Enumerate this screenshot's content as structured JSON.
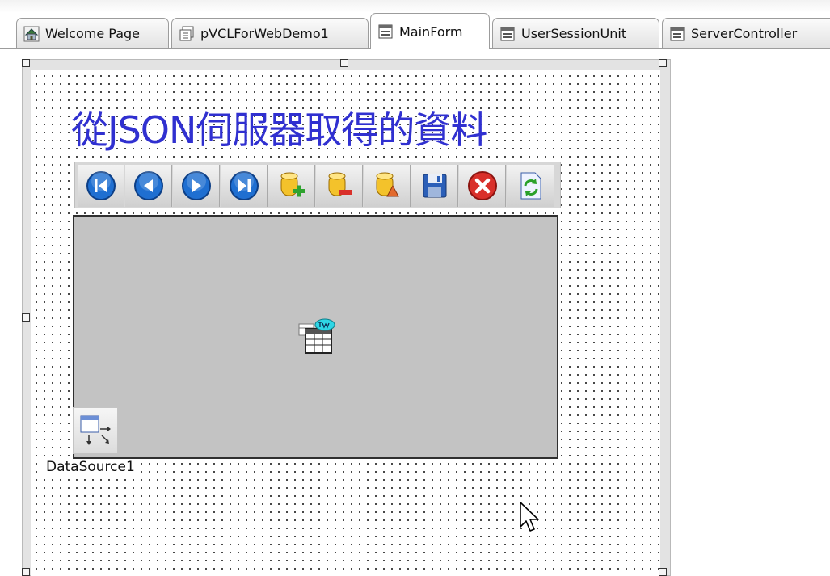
{
  "tabs": [
    {
      "label": "Welcome Page",
      "icon": "home-icon"
    },
    {
      "label": "pVCLForWebDemo1",
      "icon": "project-icon"
    },
    {
      "label": "MainForm",
      "icon": "form-icon",
      "active": true
    },
    {
      "label": "UserSessionUnit",
      "icon": "form-icon"
    },
    {
      "label": "ServerController",
      "icon": "form-icon"
    }
  ],
  "form": {
    "title_label": "從JSON伺服器取得的資料",
    "navigator_buttons": [
      "first-record-icon",
      "prior-record-icon",
      "next-record-icon",
      "last-record-icon",
      "insert-record-icon",
      "delete-record-icon",
      "edit-record-icon",
      "post-record-icon",
      "cancel-record-icon",
      "refresh-record-icon"
    ],
    "datasource_label": "DataSource1"
  },
  "colors": {
    "title_text": "#3030d0",
    "grid_background": "#c3c3c3",
    "nav_blue": "#1f6fd1",
    "cancel_red": "#d9302a"
  }
}
